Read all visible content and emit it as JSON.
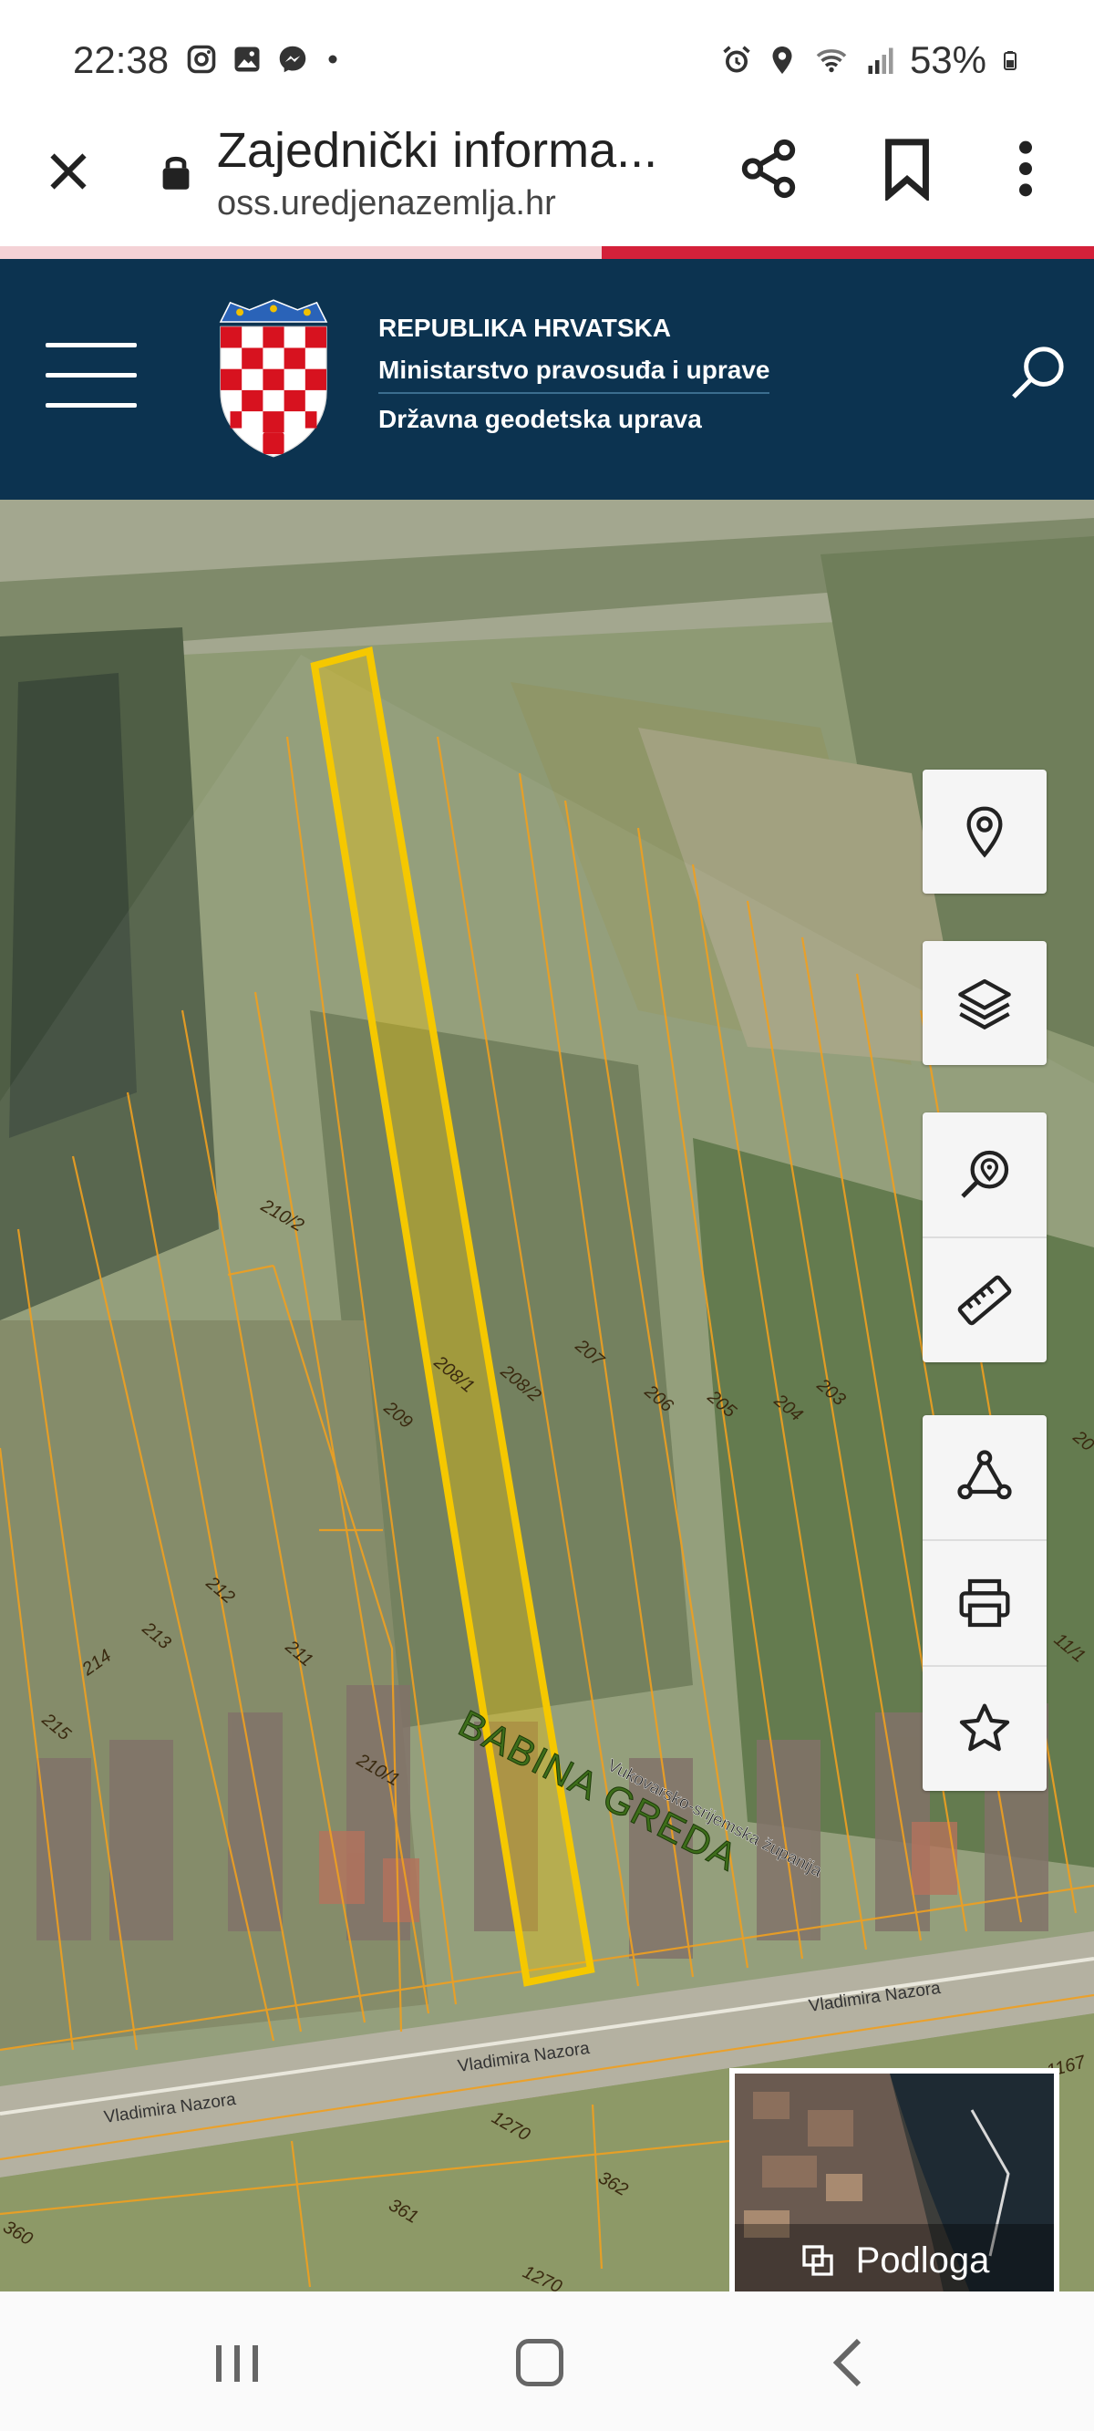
{
  "status_bar": {
    "time": "22:38",
    "left_icons": [
      "instagram-icon",
      "gallery-icon",
      "messenger-icon",
      "dot-icon"
    ],
    "right_icons": [
      "alarm-icon",
      "location-icon",
      "wifi-icon",
      "signal-icon",
      "battery-icon"
    ],
    "battery": "53%"
  },
  "browser": {
    "title": "Zajednički informa...",
    "url": "oss.uredjenazemlja.hr"
  },
  "header": {
    "line1": "REPUBLIKA HRVATSKA",
    "line2": "Ministarstvo pravosuđa i uprave",
    "line3": "Državna geodetska uprava"
  },
  "map": {
    "parcel_labels": [
      "210/2",
      "208/1",
      "208/2",
      "207",
      "206",
      "205",
      "204",
      "203",
      "209",
      "212",
      "213",
      "214",
      "215",
      "211",
      "210/1",
      "361",
      "362",
      "360",
      "1270",
      "1270",
      "1167",
      "11/1",
      "20"
    ],
    "place_name": "BABINA GREDA",
    "county_label": "Vukovarsko-srijemska županija",
    "street_labels": [
      "Vladimira Nazora",
      "Vladimira Nazora",
      "Vladimira Nazora"
    ],
    "highlight_color": "#f5c800"
  },
  "map_controls": {
    "icons": [
      "location-pin-icon",
      "layers-icon",
      "search-location-icon",
      "ruler-icon",
      "polygon-icon",
      "print-icon",
      "star-icon"
    ]
  },
  "basemap": {
    "label": "Podloga"
  },
  "navbar": {
    "icons": [
      "recents-icon",
      "home-icon",
      "back-icon"
    ]
  }
}
